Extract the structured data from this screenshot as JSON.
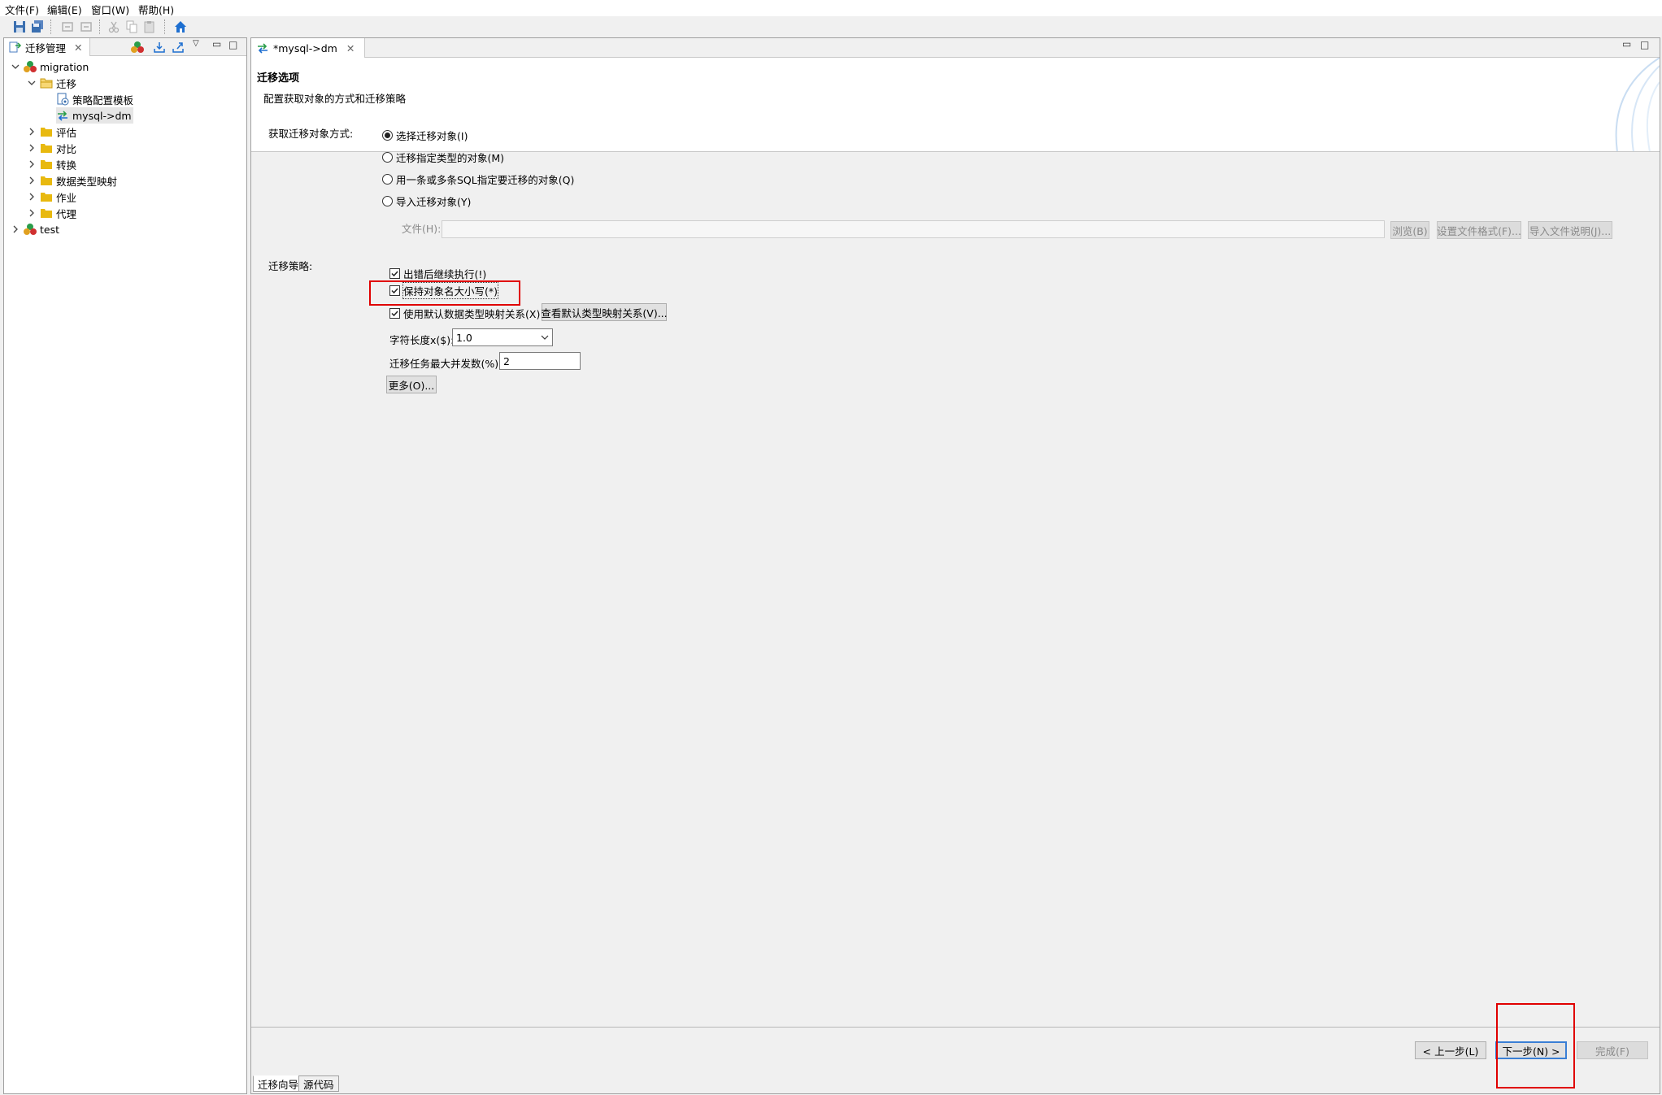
{
  "menubar": {
    "file": "文件(F)",
    "edit": "编辑(E)",
    "window": "窗口(W)",
    "help": "帮助(H)"
  },
  "left_panel": {
    "tab_title": "迁移管理",
    "tree": {
      "root1": "migration",
      "migrate_folder": "迁移",
      "strategy_template": "策略配置模板",
      "task": "mysql->dm",
      "assess": "评估",
      "compare": "对比",
      "convert": "转换",
      "type_mapping": "数据类型映射",
      "job": "作业",
      "agent": "代理",
      "root2": "test"
    }
  },
  "editor": {
    "tab_title": "*mysql->dm",
    "banner_title": "迁移选项",
    "banner_desc": "配置获取对象的方式和迁移策略",
    "acquire_label": "获取迁移对象方式:",
    "radio_options": [
      {
        "label": "选择迁移对象(I)",
        "checked": true
      },
      {
        "label": "迁移指定类型的对象(M)",
        "checked": false
      },
      {
        "label": "用一条或多条SQL指定要迁移的对象(Q)",
        "checked": false
      },
      {
        "label": "导入迁移对象(Y)",
        "checked": false
      }
    ],
    "file_label": "文件(H):",
    "file_value": "",
    "browse_btn": "浏览(B)",
    "set_format_btn": "设置文件格式(F)...",
    "import_desc_btn": "导入文件说明(J)...",
    "strategy_label": "迁移策略:",
    "checkboxes": [
      {
        "label": "出错后继续执行(!)",
        "checked": true
      },
      {
        "label": "保持对象名大小写(*)",
        "checked": true
      },
      {
        "label": "使用默认数据类型映射关系(X)",
        "checked": true
      }
    ],
    "view_mapping_btn": "查看默认类型映射关系(V)...",
    "char_len_label": "字符长度x($):",
    "char_len_value": "1.0",
    "max_concurrency_label": "迁移任务最大并发数(%):",
    "max_concurrency_value": "2",
    "more_btn": "更多(O)...",
    "prev_btn": "< 上一步(L)",
    "next_btn": "下一步(N) >",
    "finish_btn": "完成(F)",
    "bottom_tabs": [
      "迁移向导",
      "源代码"
    ]
  },
  "colors": {
    "highlight": "#e00000",
    "selection": "#e6e6e6",
    "folder": "#e8b90f"
  }
}
